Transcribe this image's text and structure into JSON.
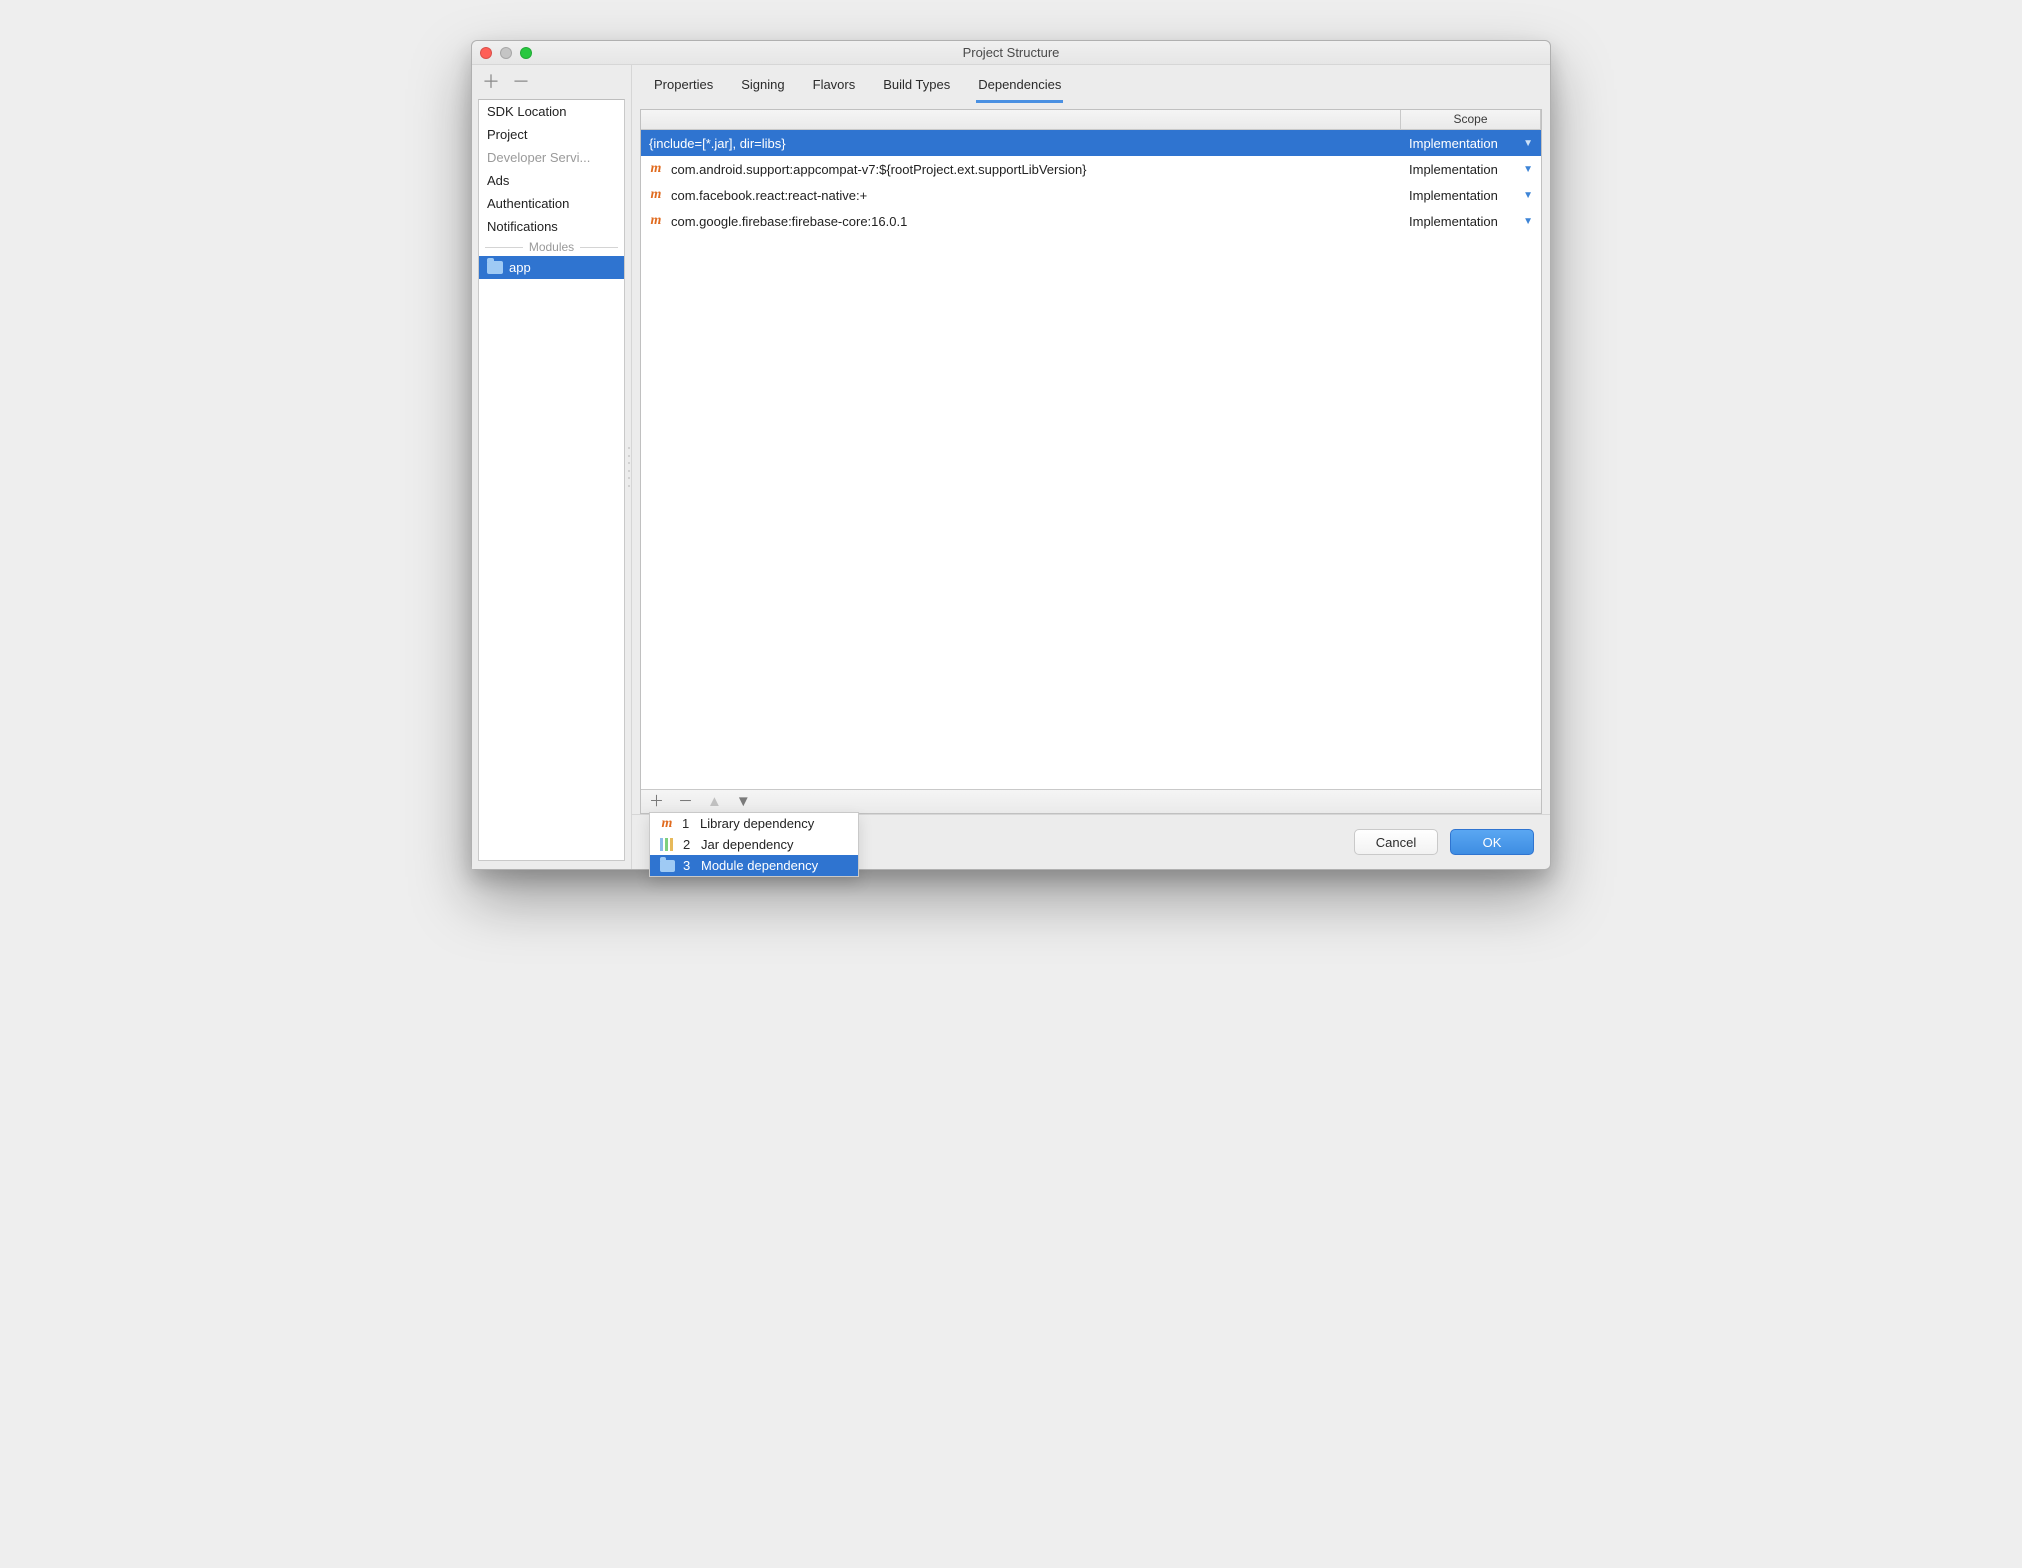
{
  "window": {
    "title": "Project Structure"
  },
  "sidebar": {
    "items": [
      {
        "label": "SDK Location",
        "dim": false
      },
      {
        "label": "Project",
        "dim": false
      },
      {
        "label": "Developer Servi...",
        "dim": true
      },
      {
        "label": "Ads",
        "dim": false
      },
      {
        "label": "Authentication",
        "dim": false
      },
      {
        "label": "Notifications",
        "dim": false
      }
    ],
    "modules_header": "Modules",
    "module": "app"
  },
  "tabs": [
    {
      "label": "Properties",
      "active": false
    },
    {
      "label": "Signing",
      "active": false
    },
    {
      "label": "Flavors",
      "active": false
    },
    {
      "label": "Build Types",
      "active": false
    },
    {
      "label": "Dependencies",
      "active": true
    }
  ],
  "table": {
    "headers": {
      "name": "",
      "scope": "Scope"
    },
    "rows": [
      {
        "icon": "",
        "name": "{include=[*.jar], dir=libs}",
        "scope": "Implementation",
        "selected": true
      },
      {
        "icon": "m",
        "name": "com.android.support:appcompat-v7:${rootProject.ext.supportLibVersion}",
        "scope": "Implementation",
        "selected": false
      },
      {
        "icon": "m",
        "name": "com.facebook.react:react-native:+",
        "scope": "Implementation",
        "selected": false
      },
      {
        "icon": "m",
        "name": "com.google.firebase:firebase-core:16.0.1",
        "scope": "Implementation",
        "selected": false
      }
    ]
  },
  "popup": {
    "items": [
      {
        "icon": "m",
        "num": "1",
        "label": "Library dependency",
        "selected": false
      },
      {
        "icon": "jar",
        "num": "2",
        "label": "Jar dependency",
        "selected": false
      },
      {
        "icon": "folder",
        "num": "3",
        "label": "Module dependency",
        "selected": true
      }
    ]
  },
  "footer": {
    "cancel": "Cancel",
    "ok": "OK"
  }
}
